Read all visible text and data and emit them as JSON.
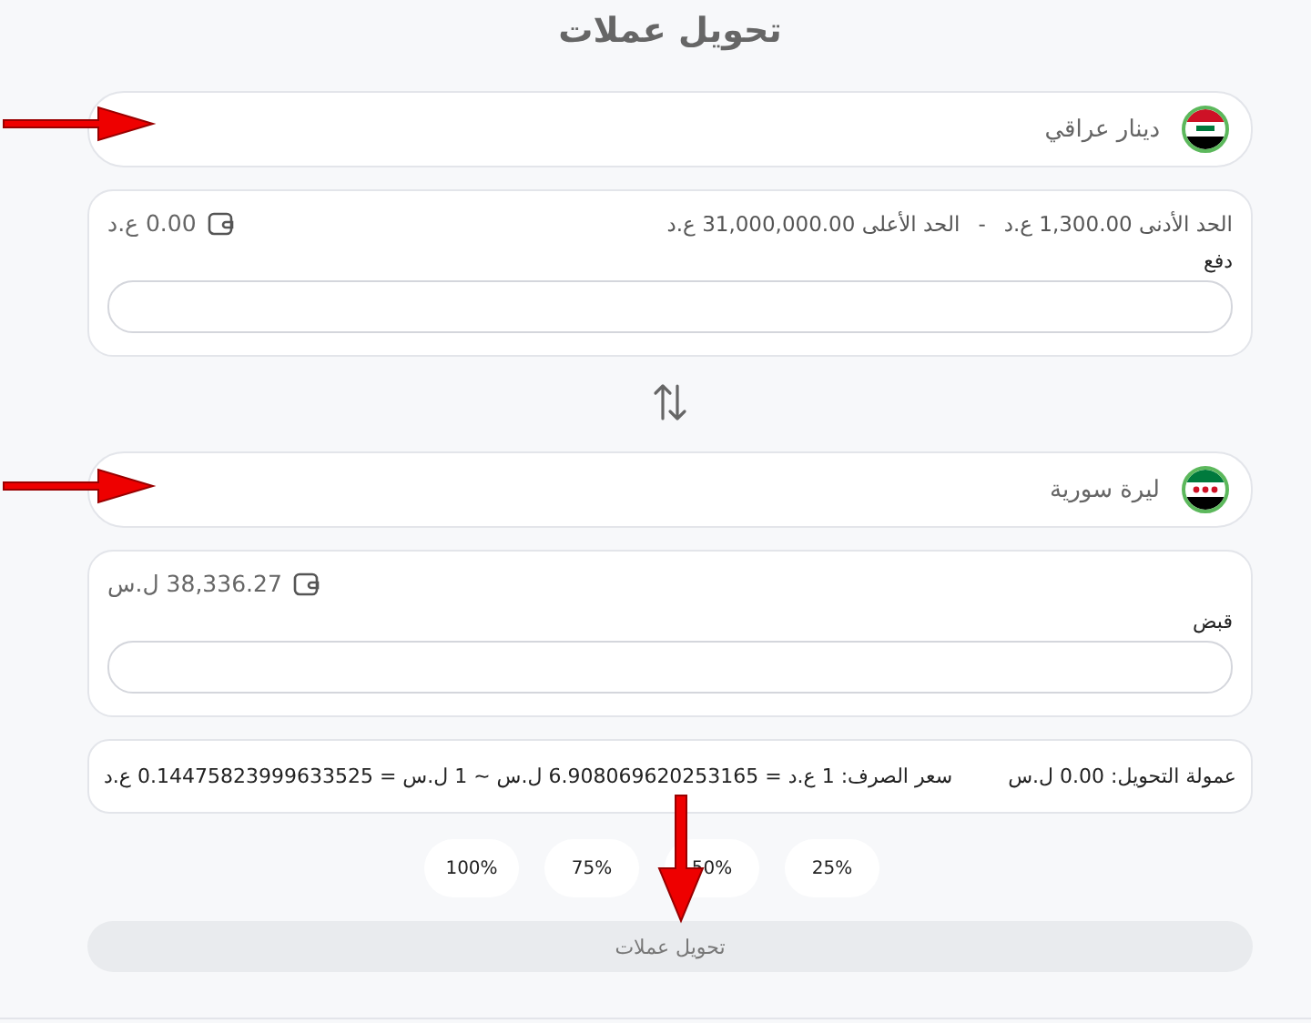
{
  "title": "تحويل عملات",
  "sections": [
    {
      "kind": "send",
      "currency": {
        "name": "دينار عراقي",
        "kind": "iq"
      },
      "limits": {
        "min": "الحد الأدنى 1,300.00 ع.د",
        "separator": "-",
        "max": "الحد الأعلى 31,000,000.00 ع.د"
      },
      "balance": "0.00 ع.د",
      "field_label": "دفع"
    },
    {
      "kind": "receive",
      "currency": {
        "name": "ليرة سورية",
        "kind": "sy"
      },
      "balance": "38,336.27 ل.س",
      "field_label": "قبض"
    }
  ],
  "fee": "عمولة التحويل: 0.00 ل.س",
  "rate": "سعر الصرف: 1 ع.د = 6.908069620253165 ل.س ~ 1 ل.س = 0.14475823999633525 ع.د",
  "percent_buttons": [
    "25%",
    "50%",
    "75%",
    "100%"
  ],
  "convert_button": {
    "label": "تحويل عملات",
    "disabled": true
  }
}
